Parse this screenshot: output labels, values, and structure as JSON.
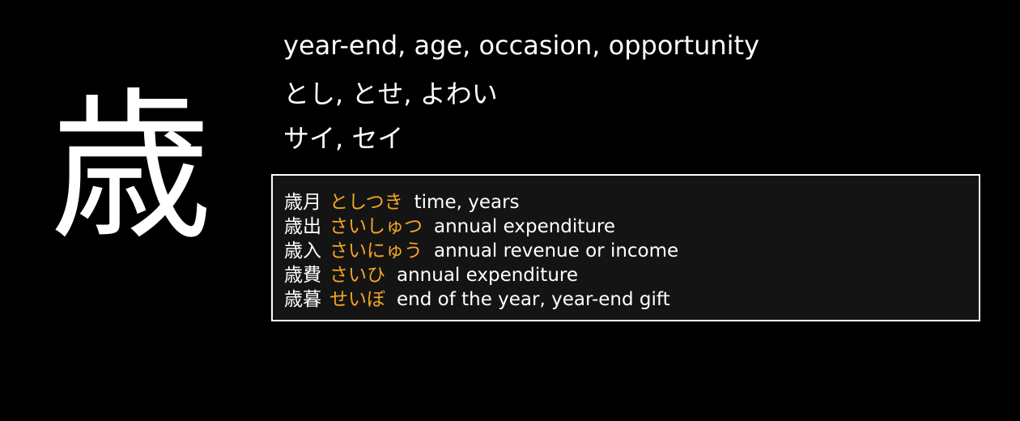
{
  "kanji": {
    "character": "歳",
    "meaning": "year-end, age, occasion, opportunity",
    "kun_readings": "とし, とせ, よわい",
    "on_readings": "サイ, セイ"
  },
  "vocabulary": [
    {
      "word": "歳月",
      "reading": "としつき",
      "gloss": "time, years"
    },
    {
      "word": "歳出",
      "reading": "さいしゅつ",
      "gloss": "annual expenditure"
    },
    {
      "word": "歳入",
      "reading": "さいにゅう",
      "gloss": "annual revenue or income"
    },
    {
      "word": "歳費",
      "reading": "さいひ",
      "gloss": "annual expenditure"
    },
    {
      "word": "歳暮",
      "reading": "せいぼ",
      "gloss": "end of the year, year-end gift"
    }
  ],
  "colors": {
    "background": "#000000",
    "text": "#ffffff",
    "reading_accent": "#f5a623",
    "vocab_box_background": "#141414",
    "vocab_box_border": "#ffffff"
  }
}
